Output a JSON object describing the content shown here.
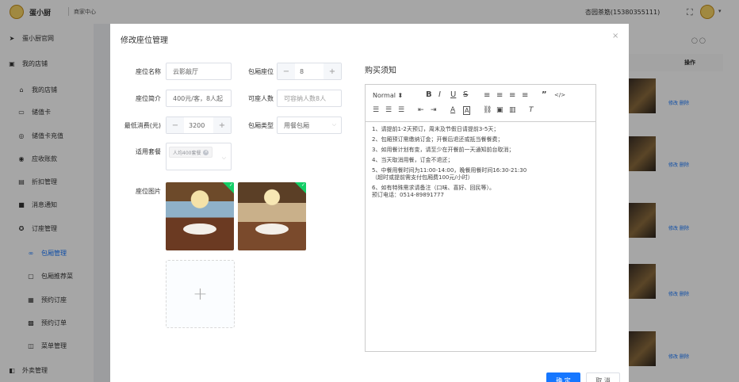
{
  "topbar": {
    "brand": "蛋小厨",
    "merchant_center": "商家中心",
    "user": "杏园茶筋(15380355111)",
    "fullscreen_icon": "fullscreen-icon",
    "avatar_icon": "avatar",
    "caret": "▾"
  },
  "sidebar": {
    "items": [
      {
        "label": "蛋小厨官网",
        "icon": "send-icon"
      },
      {
        "label": "我的店铺",
        "icon": "store-icon"
      },
      {
        "label": "我的店铺",
        "icon": "home-icon"
      },
      {
        "label": "储值卡",
        "icon": "card-icon"
      },
      {
        "label": "储值卡充值",
        "icon": "recharge-icon"
      },
      {
        "label": "应收账款",
        "icon": "money-icon"
      },
      {
        "label": "折扣管理",
        "icon": "discount-icon"
      },
      {
        "label": "消息通知",
        "icon": "message-icon"
      },
      {
        "label": "订座管理",
        "icon": "seat-icon"
      },
      {
        "label": "包厢管理",
        "icon": "infinity-icon"
      },
      {
        "label": "包厢推荐菜",
        "icon": "dish-icon"
      },
      {
        "label": "预约订座",
        "icon": "calendar-icon"
      },
      {
        "label": "预约订单",
        "icon": "order-icon"
      },
      {
        "label": "菜单管理",
        "icon": "menu-icon"
      },
      {
        "label": "外卖管理",
        "icon": "takeout-icon"
      }
    ]
  },
  "background": {
    "header": "操作",
    "edit": "修改",
    "delete": "删除"
  },
  "modal": {
    "title": "修改座位管理",
    "close": "×",
    "seat_name_label": "座位名称",
    "seat_name_value": "云影敲厅",
    "box_seats_label": "包厢座位",
    "box_seats_value": "8",
    "seat_intro_label": "座位简介",
    "seat_intro_value": "400元/客，8人起",
    "capacity_label": "可座人数",
    "capacity_placeholder": "可容纳人数8人",
    "min_spend_label": "最低消费(元)",
    "min_spend_value": "3200",
    "box_type_label": "包厢类型",
    "box_type_value": "用餐包厢",
    "package_label": "适用套餐",
    "package_tag": "人均400套餐",
    "images_label": "座位图片",
    "notice_title": "购买须知",
    "editor": {
      "format": "Normal",
      "lines": [
        "1、请提前1-2天预订，周末及节假日请提前3-5天；",
        "2、包厢预订需缴纳订金；开餐后退还或抵当餐餐费；",
        "3、如用餐计划有变，请至少在开餐前一天通知前台取消；",
        "4、当天取消用餐，订金不退还；",
        "5、中餐用餐时间为11:00-14:00，晚餐用餐时间16:30-21:30\n（超时或提前需支付包厢费100元/小时）",
        "6、如有特殊需求请备注（口味、喜好、回民等）。\n预订电话：0514-89891777"
      ]
    },
    "confirm": "确 定",
    "cancel": "取 消"
  }
}
